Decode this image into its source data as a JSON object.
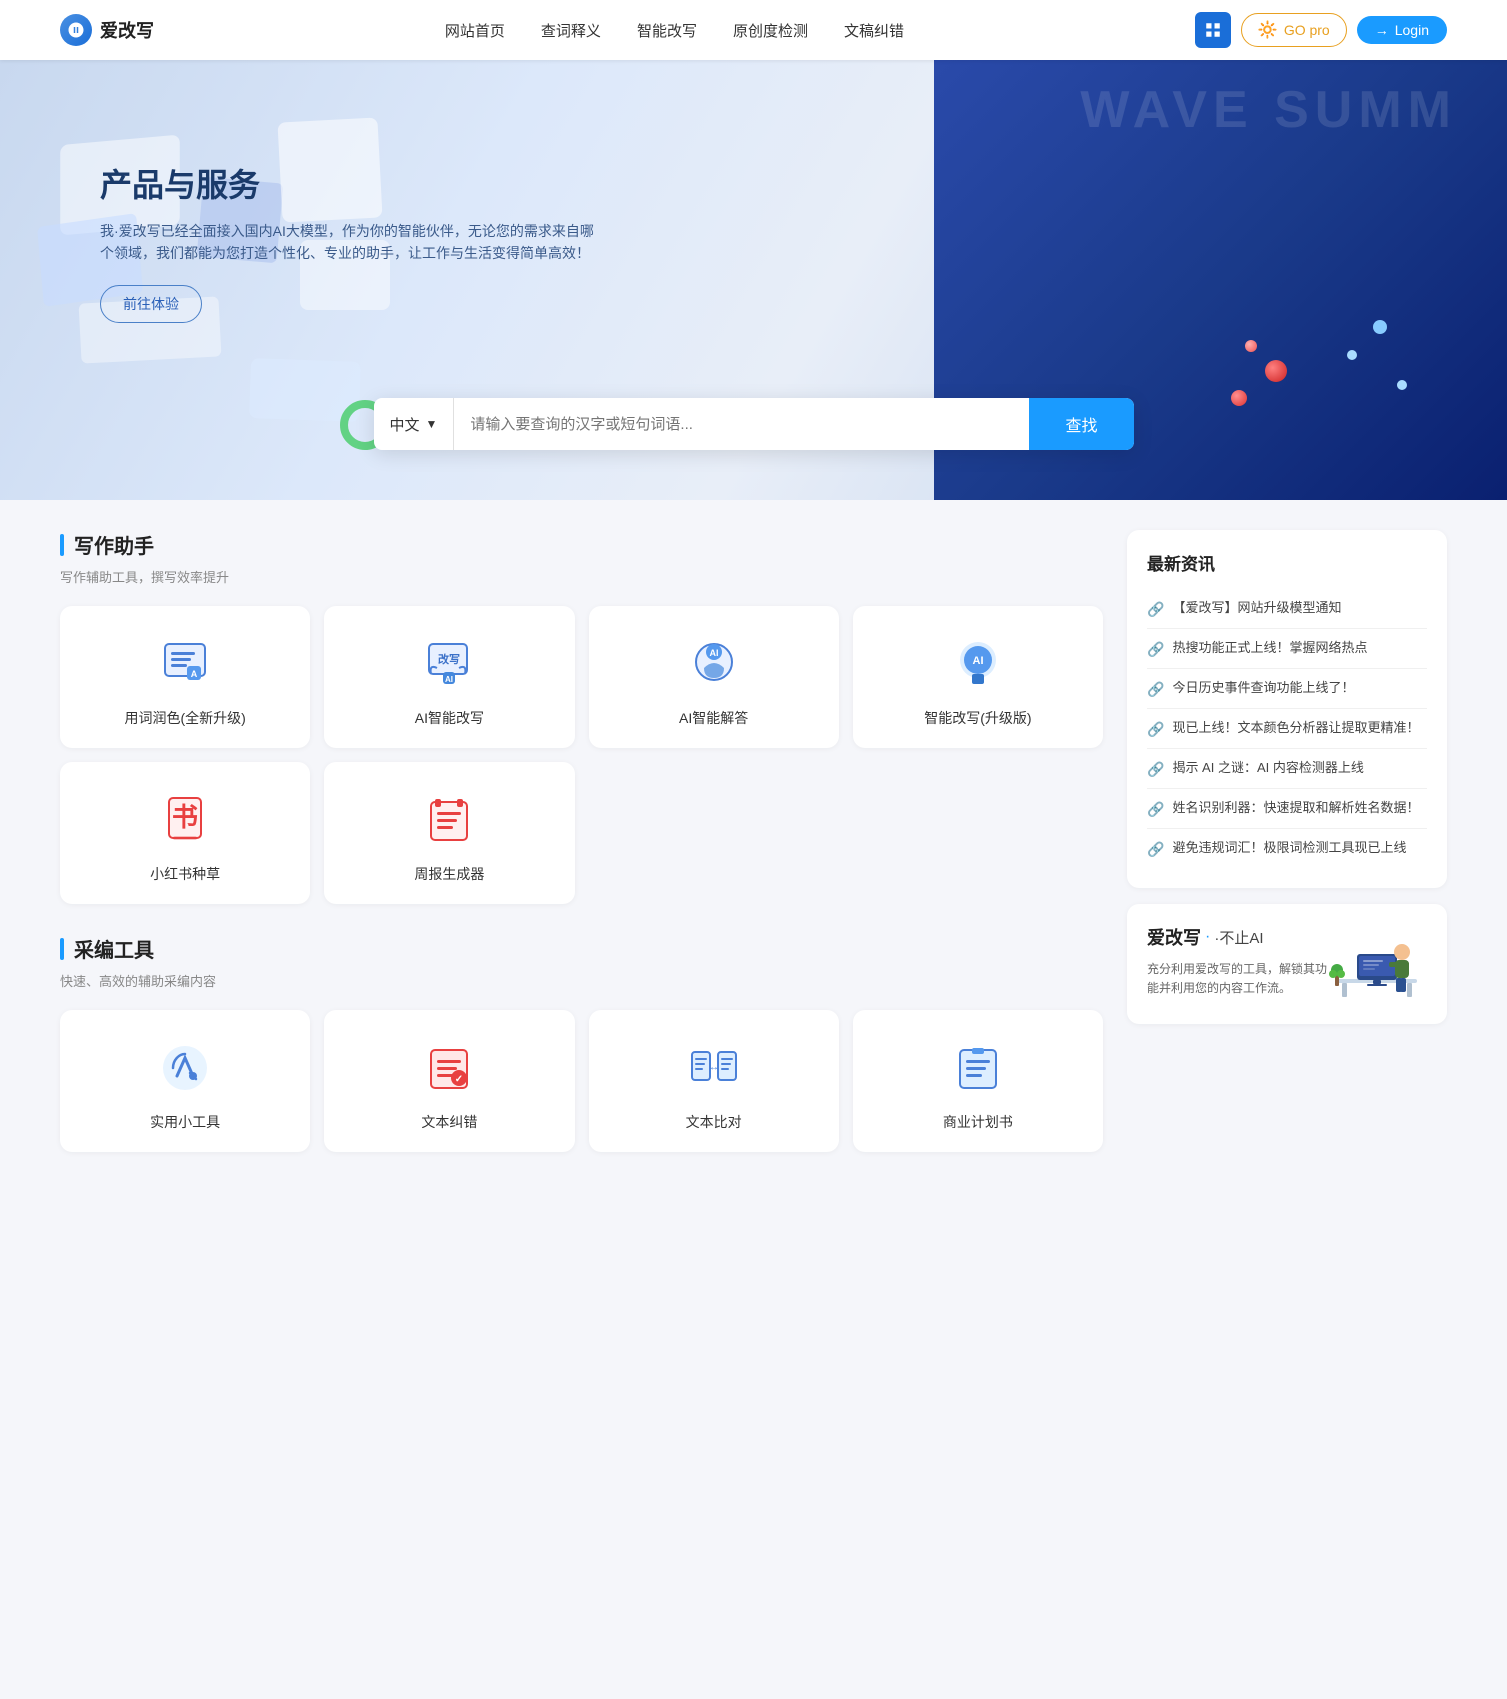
{
  "navbar": {
    "logo_text": "爱改写",
    "links": [
      {
        "label": "网站首页",
        "href": "#"
      },
      {
        "label": "查词释义",
        "href": "#"
      },
      {
        "label": "智能改写",
        "href": "#"
      },
      {
        "label": "原创度检测",
        "href": "#"
      },
      {
        "label": "文稿纠错",
        "href": "#"
      }
    ],
    "btn_grid_label": "grid",
    "btn_gopro_label": "GO pro",
    "btn_login_label": "Login"
  },
  "hero": {
    "title": "产品与服务",
    "desc": "我·爱改写已经全面接入国内AI大模型，作为你的智能伙伴，无论您的需求来自哪个领域，我们都能为您打造个性化、专业的助手，让工作与生活变得简单高效！",
    "btn_label": "前往体验",
    "wave_text": "WAVE SUMM"
  },
  "search": {
    "lang": "中文",
    "placeholder": "请输入要查询的汉字或短句词语...",
    "btn_label": "查找"
  },
  "writing_section": {
    "title": "写作助手",
    "subtitle": "写作辅助工具，撰写效率提升",
    "tools": [
      {
        "name": "用词润色(全新升级)",
        "icon_type": "writing-brush"
      },
      {
        "name": "AI智能改写",
        "icon_type": "ai-rewrite"
      },
      {
        "name": "AI智能解答",
        "icon_type": "ai-answer"
      },
      {
        "name": "智能改写(升级版)",
        "icon_type": "smart-rewrite"
      },
      {
        "name": "小红书种草",
        "icon_type": "redbook"
      },
      {
        "name": "周报生成器",
        "icon_type": "weekly-report"
      }
    ]
  },
  "editing_section": {
    "title": "采编工具",
    "subtitle": "快速、高效的辅助采编内容",
    "tools": [
      {
        "name": "实用小工具",
        "icon_type": "tools"
      },
      {
        "name": "文本纠错",
        "icon_type": "text-correct"
      },
      {
        "name": "文本比对",
        "icon_type": "text-compare"
      },
      {
        "name": "商业计划书",
        "icon_type": "business-plan"
      }
    ]
  },
  "news": {
    "title": "最新资讯",
    "items": [
      {
        "text": "【爱改写】网站升级模型通知"
      },
      {
        "text": "热搜功能正式上线！掌握网络热点"
      },
      {
        "text": "今日历史事件查询功能上线了！"
      },
      {
        "text": "现已上线！文本颜色分析器让提取更精准！"
      },
      {
        "text": "揭示 AI 之谜：AI 内容检测器上线"
      },
      {
        "text": "姓名识别利器：快速提取和解析姓名数据！"
      },
      {
        "text": "避免违规词汇！极限词检测工具现已上线"
      }
    ]
  },
  "promo": {
    "title": "爱改写",
    "title_suffix": "·不止AI",
    "desc": "充分利用爱改写的工具，解锁其功能并利用您的内容工作流。"
  }
}
